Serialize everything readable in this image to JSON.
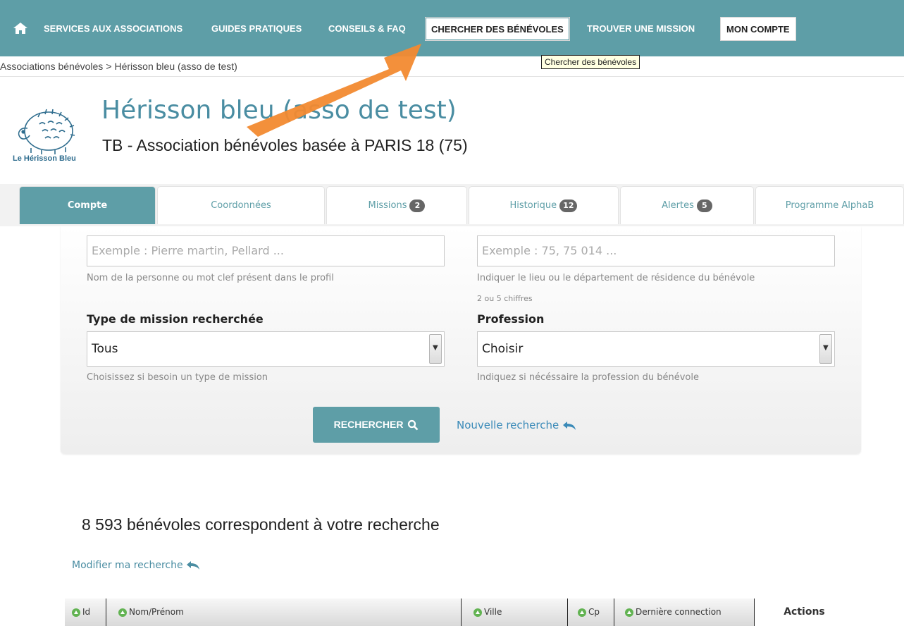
{
  "nav": {
    "items": [
      "SERVICES AUX ASSOCIATIONS",
      "GUIDES PRATIQUES",
      "CONSEILS & FAQ",
      "CHERCHER DES BÉNÉVOLES",
      "TROUVER UNE MISSION",
      "MON COMPTE"
    ],
    "tooltip": "Chercher des bénévoles",
    "accent_color": "#5e9ea7"
  },
  "breadcrumb": {
    "root": "Associations bénévoles",
    "separator": ">",
    "current": "Hérisson bleu (asso de test)"
  },
  "header": {
    "logo_text": "Le Hérisson Bleu",
    "title": "Hérisson bleu (asso de test)",
    "subtitle": "TB - Association bénévoles basée à PARIS 18 (75)"
  },
  "tabs": [
    {
      "label": "Compte",
      "badge": ""
    },
    {
      "label": "Coordonnées",
      "badge": ""
    },
    {
      "label": "Missions",
      "badge": "2"
    },
    {
      "label": "Historique",
      "badge": "12"
    },
    {
      "label": "Alertes",
      "badge": "5"
    },
    {
      "label": "Programme AlphaB",
      "badge": ""
    }
  ],
  "search": {
    "name_placeholder": "Exemple : Pierre martin, Pellard ...",
    "name_help": "Nom de la personne ou mot clef présent dans le profil",
    "place_placeholder": "Exemple : 75, 75 014 ...",
    "place_help": "Indiquer le lieu ou le département de résidence du bénévole",
    "place_help2": "2 ou 5 chiffres",
    "mission_label": "Type de mission recherchée",
    "mission_value": "Tous",
    "mission_help": "Choisissez si besoin un type de mission",
    "profession_label": "Profession",
    "profession_value": "Choisir",
    "profession_help": "Indiquez si nécéssaire la profession du bénévole",
    "search_button": "RECHERCHER",
    "new_search_link": "Nouvelle recherche"
  },
  "results": {
    "count": "8 593",
    "text": "bénévoles correspondent à votre recherche",
    "modify_link": "Modifier ma recherche",
    "columns": [
      "Id",
      "Nom/Prénom",
      "Ville",
      "Cp",
      "Dernière connection",
      "Actions"
    ]
  }
}
